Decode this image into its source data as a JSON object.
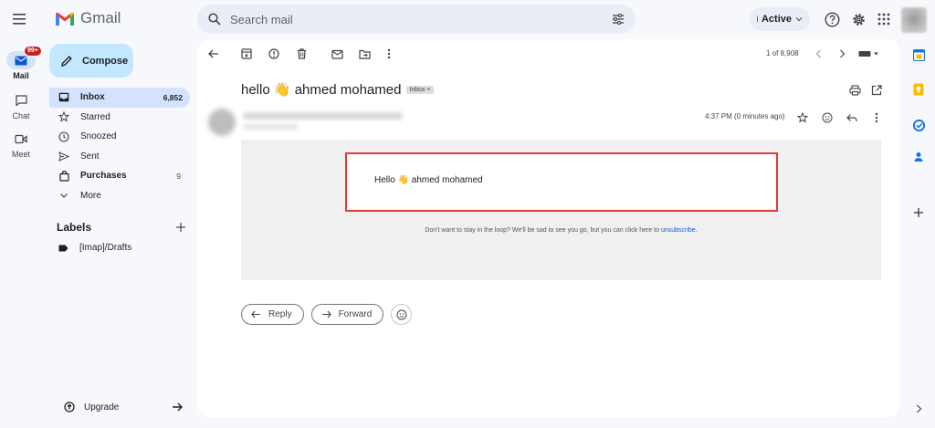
{
  "app": {
    "name": "Gmail"
  },
  "rail": {
    "mail_label": "Mail",
    "mail_badge": "99+",
    "chat_label": "Chat",
    "meet_label": "Meet"
  },
  "search": {
    "placeholder": "Search mail"
  },
  "status": {
    "label": "Active",
    "color": "#1e8e3e"
  },
  "compose": {
    "label": "Compose"
  },
  "nav": {
    "items": [
      {
        "label": "Inbox",
        "count": "6,852"
      },
      {
        "label": "Starred"
      },
      {
        "label": "Snoozed"
      },
      {
        "label": "Sent"
      },
      {
        "label": "Purchases",
        "count": "9"
      },
      {
        "label": "More"
      }
    ]
  },
  "labels": {
    "title": "Labels",
    "items": [
      {
        "label": "[Imap]/Drafts"
      }
    ]
  },
  "upgrade": {
    "label": "Upgrade"
  },
  "pagination": {
    "text": "1 of 8,908"
  },
  "email": {
    "subject": "hello 👋 ahmed mohamed",
    "tag": "Inbox ×",
    "time": "4:37 PM (0 minutes ago)",
    "body": "Hello 👋 ahmed mohamed",
    "footer_text": "Don't want to stay in the loop? We'll be sad to see you go, but you can click here to ",
    "footer_link": "unsubscribe",
    "footer_end": "."
  },
  "actions": {
    "reply": "Reply",
    "forward": "Forward"
  },
  "colors": {
    "background": "#f6f8fc",
    "compose": "#c2e7ff",
    "active_nav": "#d3e3fd",
    "highlight_border": "#e53935",
    "link": "#1a56c4"
  }
}
